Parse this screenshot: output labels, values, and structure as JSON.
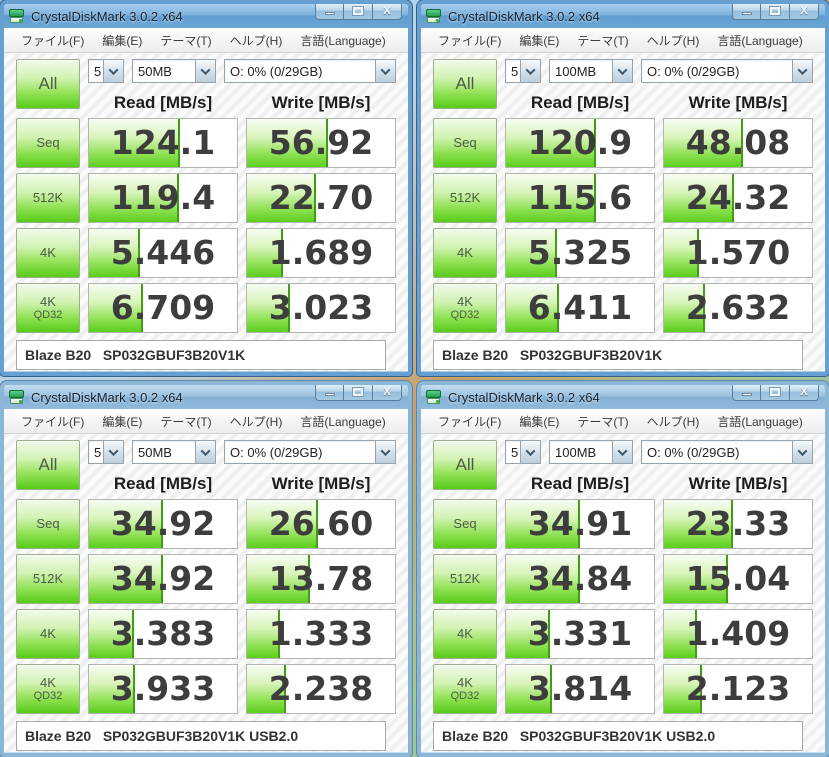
{
  "icons": {
    "app_icon": "green-disk",
    "minimize_icon": "minimize-bar",
    "maximize_icon": "maximize-square",
    "close_icon": "X",
    "combo_arrow_icon": "chevron-down"
  },
  "colors": {
    "title_active": "#6ba6d6",
    "title_inactive": "#9cc2e0",
    "window_border": "#65a0d0",
    "button_green": "#58cb1a",
    "bar_green": "#5ccd1d",
    "bar_edge": "#3f9e12",
    "value_text": "#3d3d3d"
  },
  "windows": [
    {
      "title": "CrystalDiskMark 3.0.2 x64",
      "active": true,
      "menu": [
        "ファイル(F)",
        "編集(E)",
        "テーマ(T)",
        "ヘルプ(H)",
        "言語(Language)"
      ],
      "all_label": "All",
      "test_count": "5",
      "test_size": "50MB",
      "drive": "O: 0% (0/29GB)",
      "read_header": "Read [MB/s]",
      "write_header": "Write [MB/s]",
      "rows": [
        {
          "label": "Seq",
          "sub": "",
          "read": "124.1",
          "write": "56.92",
          "read_bar": 61.2,
          "write_bar": 54.5
        },
        {
          "label": "512K",
          "sub": "",
          "read": "119.4",
          "write": "22.70",
          "read_bar": 60.9,
          "write_bar": 46.7
        },
        {
          "label": "4K",
          "sub": "",
          "read": "5.446",
          "write": "1.689",
          "read_bar": 34.6,
          "write_bar": 24.2
        },
        {
          "label": "4K",
          "sub": "QD32",
          "read": "6.709",
          "write": "3.023",
          "read_bar": 36.4,
          "write_bar": 28.9
        }
      ],
      "comment": "Blaze B20   SP032GBUF3B20V1K"
    },
    {
      "title": "CrystalDiskMark 3.0.2 x64",
      "active": true,
      "menu": [
        "ファイル(F)",
        "編集(E)",
        "テーマ(T)",
        "ヘルプ(H)",
        "言語(Language)"
      ],
      "all_label": "All",
      "test_count": "5",
      "test_size": "100MB",
      "drive": "O: 0% (0/29GB)",
      "read_header": "Read [MB/s]",
      "write_header": "Write [MB/s]",
      "rows": [
        {
          "label": "Seq",
          "sub": "",
          "read": "120.9",
          "write": "48.08",
          "read_bar": 61.0,
          "write_bar": 53.1
        },
        {
          "label": "512K",
          "sub": "",
          "read": "115.6",
          "write": "24.32",
          "read_bar": 60.6,
          "write_bar": 47.3
        },
        {
          "label": "4K",
          "sub": "",
          "read": "5.325",
          "write": "1.570",
          "read_bar": 34.4,
          "write_bar": 23.6
        },
        {
          "label": "4K",
          "sub": "QD32",
          "read": "6.411",
          "write": "2.632",
          "read_bar": 36.0,
          "write_bar": 27.9
        }
      ],
      "comment": "Blaze B20   SP032GBUF3B20V1K"
    },
    {
      "title": "CrystalDiskMark 3.0.2 x64",
      "active": false,
      "menu": [
        "ファイル(F)",
        "編集(E)",
        "テーマ(T)",
        "ヘルプ(H)",
        "言語(Language)"
      ],
      "all_label": "All",
      "test_count": "5",
      "test_size": "50MB",
      "drive": "O: 0% (0/29GB)",
      "read_header": "Read [MB/s]",
      "write_header": "Write [MB/s]",
      "rows": [
        {
          "label": "Seq",
          "sub": "",
          "read": "34.92",
          "write": "26.60",
          "read_bar": 50.3,
          "write_bar": 48.0
        },
        {
          "label": "512K",
          "sub": "",
          "read": "34.92",
          "write": "13.78",
          "read_bar": 50.3,
          "write_bar": 42.5
        },
        {
          "label": "4K",
          "sub": "",
          "read": "3.383",
          "write": "1.333",
          "read_bar": 30.1,
          "write_bar": 22.2
        },
        {
          "label": "4K",
          "sub": "QD32",
          "read": "3.933",
          "write": "2.238",
          "read_bar": 31.2,
          "write_bar": 26.4
        }
      ],
      "comment": "Blaze B20   SP032GBUF3B20V1K USB2.0"
    },
    {
      "title": "CrystalDiskMark 3.0.2 x64",
      "active": false,
      "menu": [
        "ファイル(F)",
        "編集(E)",
        "テーマ(T)",
        "ヘルプ(H)",
        "言語(Language)"
      ],
      "all_label": "All",
      "test_count": "5",
      "test_size": "100MB",
      "drive": "O: 0% (0/29GB)",
      "read_header": "Read [MB/s]",
      "write_header": "Write [MB/s]",
      "rows": [
        {
          "label": "Seq",
          "sub": "",
          "read": "34.91",
          "write": "23.33",
          "read_bar": 50.3,
          "write_bar": 46.9
        },
        {
          "label": "512K",
          "sub": "",
          "read": "34.84",
          "write": "15.04",
          "read_bar": 50.3,
          "write_bar": 43.2
        },
        {
          "label": "4K",
          "sub": "",
          "read": "3.331",
          "write": "1.409",
          "read_bar": 30.0,
          "write_bar": 22.6
        },
        {
          "label": "4K",
          "sub": "QD32",
          "read": "3.814",
          "write": "2.123",
          "read_bar": 31.1,
          "write_bar": 25.9
        }
      ],
      "comment": "Blaze B20   SP032GBUF3B20V1K USB2.0"
    }
  ]
}
